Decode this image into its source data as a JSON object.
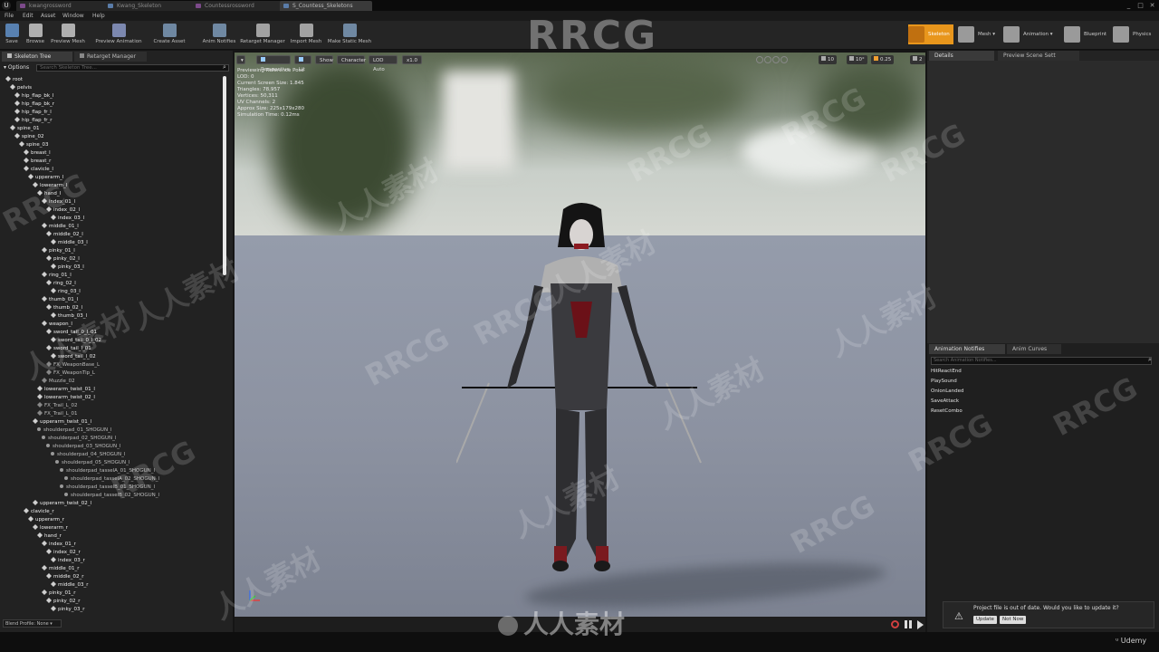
{
  "tabs": [
    {
      "label": "kwangrossword",
      "color": "#7c4a8a"
    },
    {
      "label": "Kwang_Skeleton",
      "color": "#5a7ca8"
    },
    {
      "label": "Countessrossword",
      "color": "#7c4a8a"
    },
    {
      "label": "S_Countess_Skeletons",
      "color": "#5a7ca8"
    }
  ],
  "menu": [
    "File",
    "Edit",
    "Asset",
    "Window",
    "Help"
  ],
  "toolbar": [
    {
      "label": "Save",
      "icon": "save-icon"
    },
    {
      "label": "Browse",
      "icon": "browse-icon"
    },
    {
      "label": "Preview Mesh",
      "icon": "preview-mesh-icon"
    },
    {
      "label": "Preview Animation",
      "icon": "preview-animation-icon"
    },
    {
      "label": "Create Asset",
      "icon": "create-asset-icon"
    },
    {
      "label": "Anim Notifies",
      "icon": "anim-notifies-icon"
    },
    {
      "label": "Retarget Manager",
      "icon": "retarget-manager-icon"
    },
    {
      "label": "Import Mesh",
      "icon": "import-mesh-icon"
    },
    {
      "label": "Make Static Mesh",
      "icon": "make-static-mesh-icon"
    }
  ],
  "modes": [
    "Skeleton",
    "Mesh",
    "Animation",
    "Blueprint",
    "Physics"
  ],
  "left_panel": {
    "tabs": [
      "Skeleton Tree",
      "Retarget Manager"
    ],
    "options": "Options",
    "search_placeholder": "Search Skeleton Tree...",
    "blend_profile": "Blend Profile: None",
    "tree": [
      {
        "label": "root",
        "d": 0
      },
      {
        "label": "pelvis",
        "d": 1
      },
      {
        "label": "hip_flap_bk_l",
        "d": 2
      },
      {
        "label": "hip_flap_bk_r",
        "d": 2
      },
      {
        "label": "hip_flap_fr_l",
        "d": 2
      },
      {
        "label": "hip_flap_fr_r",
        "d": 2
      },
      {
        "label": "spine_01",
        "d": 1
      },
      {
        "label": "spine_02",
        "d": 2
      },
      {
        "label": "spine_03",
        "d": 3
      },
      {
        "label": "breast_l",
        "d": 4
      },
      {
        "label": "breast_r",
        "d": 4
      },
      {
        "label": "clavicle_l",
        "d": 4
      },
      {
        "label": "upperarm_l",
        "d": 5
      },
      {
        "label": "lowerarm_l",
        "d": 6
      },
      {
        "label": "hand_l",
        "d": 7
      },
      {
        "label": "index_01_l",
        "d": 8
      },
      {
        "label": "index_02_l",
        "d": 9
      },
      {
        "label": "index_03_l",
        "d": 10
      },
      {
        "label": "middle_01_l",
        "d": 8
      },
      {
        "label": "middle_02_l",
        "d": 9
      },
      {
        "label": "middle_03_l",
        "d": 10
      },
      {
        "label": "pinky_01_l",
        "d": 8
      },
      {
        "label": "pinky_02_l",
        "d": 9
      },
      {
        "label": "pinky_03_l",
        "d": 10
      },
      {
        "label": "ring_01_l",
        "d": 8
      },
      {
        "label": "ring_02_l",
        "d": 9
      },
      {
        "label": "ring_03_l",
        "d": 10
      },
      {
        "label": "thumb_01_l",
        "d": 8
      },
      {
        "label": "thumb_02_l",
        "d": 9
      },
      {
        "label": "thumb_03_l",
        "d": 10
      },
      {
        "label": "weapon_l",
        "d": 8
      },
      {
        "label": "sword_tail_0_l_01",
        "d": 9
      },
      {
        "label": "sword_tail_0_l_02",
        "d": 10
      },
      {
        "label": "sword_tail_l_01",
        "d": 9
      },
      {
        "label": "sword_tail_l_02",
        "d": 10
      },
      {
        "label": "FX_WeaponBase_L",
        "d": 9,
        "s": 1
      },
      {
        "label": "FX_WeaponTip_L",
        "d": 9,
        "s": 1
      },
      {
        "label": "Muzzle_02",
        "d": 8,
        "s": 1
      },
      {
        "label": "lowerarm_twist_01_l",
        "d": 7
      },
      {
        "label": "lowerarm_twist_02_l",
        "d": 7
      },
      {
        "label": "FX_Trail_L_02",
        "d": 7,
        "s": 1
      },
      {
        "label": "FX_Trail_L_01",
        "d": 7,
        "s": 1
      },
      {
        "label": "upperarm_twist_01_l",
        "d": 6
      },
      {
        "label": "shoulderpad_01_SHOGUN_l",
        "d": 7,
        "s": 2
      },
      {
        "label": "shoulderpad_02_SHOGUN_l",
        "d": 8,
        "s": 2
      },
      {
        "label": "shoulderpad_03_SHOGUN_l",
        "d": 9,
        "s": 2
      },
      {
        "label": "shoulderpad_04_SHOGUN_l",
        "d": 10,
        "s": 2
      },
      {
        "label": "shoulderpad_05_SHOGUN_l",
        "d": 11,
        "s": 2
      },
      {
        "label": "shoulderpad_tasselA_01_SHOGUN_l",
        "d": 12,
        "s": 2
      },
      {
        "label": "shoulderpad_tasselA_02_SHOGUN_l",
        "d": 13,
        "s": 2
      },
      {
        "label": "shoulderpad_tasselB_01_SHOGUN_l",
        "d": 12,
        "s": 2
      },
      {
        "label": "shoulderpad_tasselB_02_SHOGUN_l",
        "d": 13,
        "s": 2
      },
      {
        "label": "upperarm_twist_02_l",
        "d": 6
      },
      {
        "label": "clavicle_r",
        "d": 4
      },
      {
        "label": "upperarm_r",
        "d": 5
      },
      {
        "label": "lowerarm_r",
        "d": 6
      },
      {
        "label": "hand_r",
        "d": 7
      },
      {
        "label": "index_01_r",
        "d": 8
      },
      {
        "label": "index_02_r",
        "d": 9
      },
      {
        "label": "index_03_r",
        "d": 10
      },
      {
        "label": "middle_01_r",
        "d": 8
      },
      {
        "label": "middle_02_r",
        "d": 9
      },
      {
        "label": "middle_03_r",
        "d": 10
      },
      {
        "label": "pinky_01_r",
        "d": 8
      },
      {
        "label": "pinky_02_r",
        "d": 9
      },
      {
        "label": "pinky_03_r",
        "d": 10
      }
    ]
  },
  "viewport": {
    "buttons": [
      "Perspective",
      "Lit",
      "Show",
      "Character",
      "LOD Auto",
      "x1.0"
    ],
    "right_values": [
      "10",
      "10°",
      "0.25",
      "2"
    ],
    "stats": [
      "Previewing Reference Pose",
      "LOD: 0",
      "Current Screen Size: 1.845",
      "Triangles: 78,957",
      "Vertices: 50,311",
      "UV Channels: 2",
      "Approx Size: 225x179x280",
      "Simulation Time: 0.12ms"
    ]
  },
  "right_panel": {
    "tabs": [
      "Details",
      "Preview Scene Sett"
    ],
    "notif_tabs": [
      "Animation Notifies",
      "Anim Curves"
    ],
    "notif_search_placeholder": "Search Animation Notifies...",
    "notifies": [
      "HitReactEnd",
      "PlaySound",
      "OnionLanded",
      "SaveAttack",
      "ResetCombo"
    ]
  },
  "toast": {
    "message": "Project file is out of date. Would you like to update it?",
    "update_label": "Update",
    "not_now_label": "Not Now"
  },
  "watermarks": [
    "RRCG",
    "人人素材"
  ],
  "bottom_logo": "人人素材",
  "udemy": "Udemy",
  "colors": {
    "accent": "#e8961c",
    "highlight": "#f0a030"
  }
}
